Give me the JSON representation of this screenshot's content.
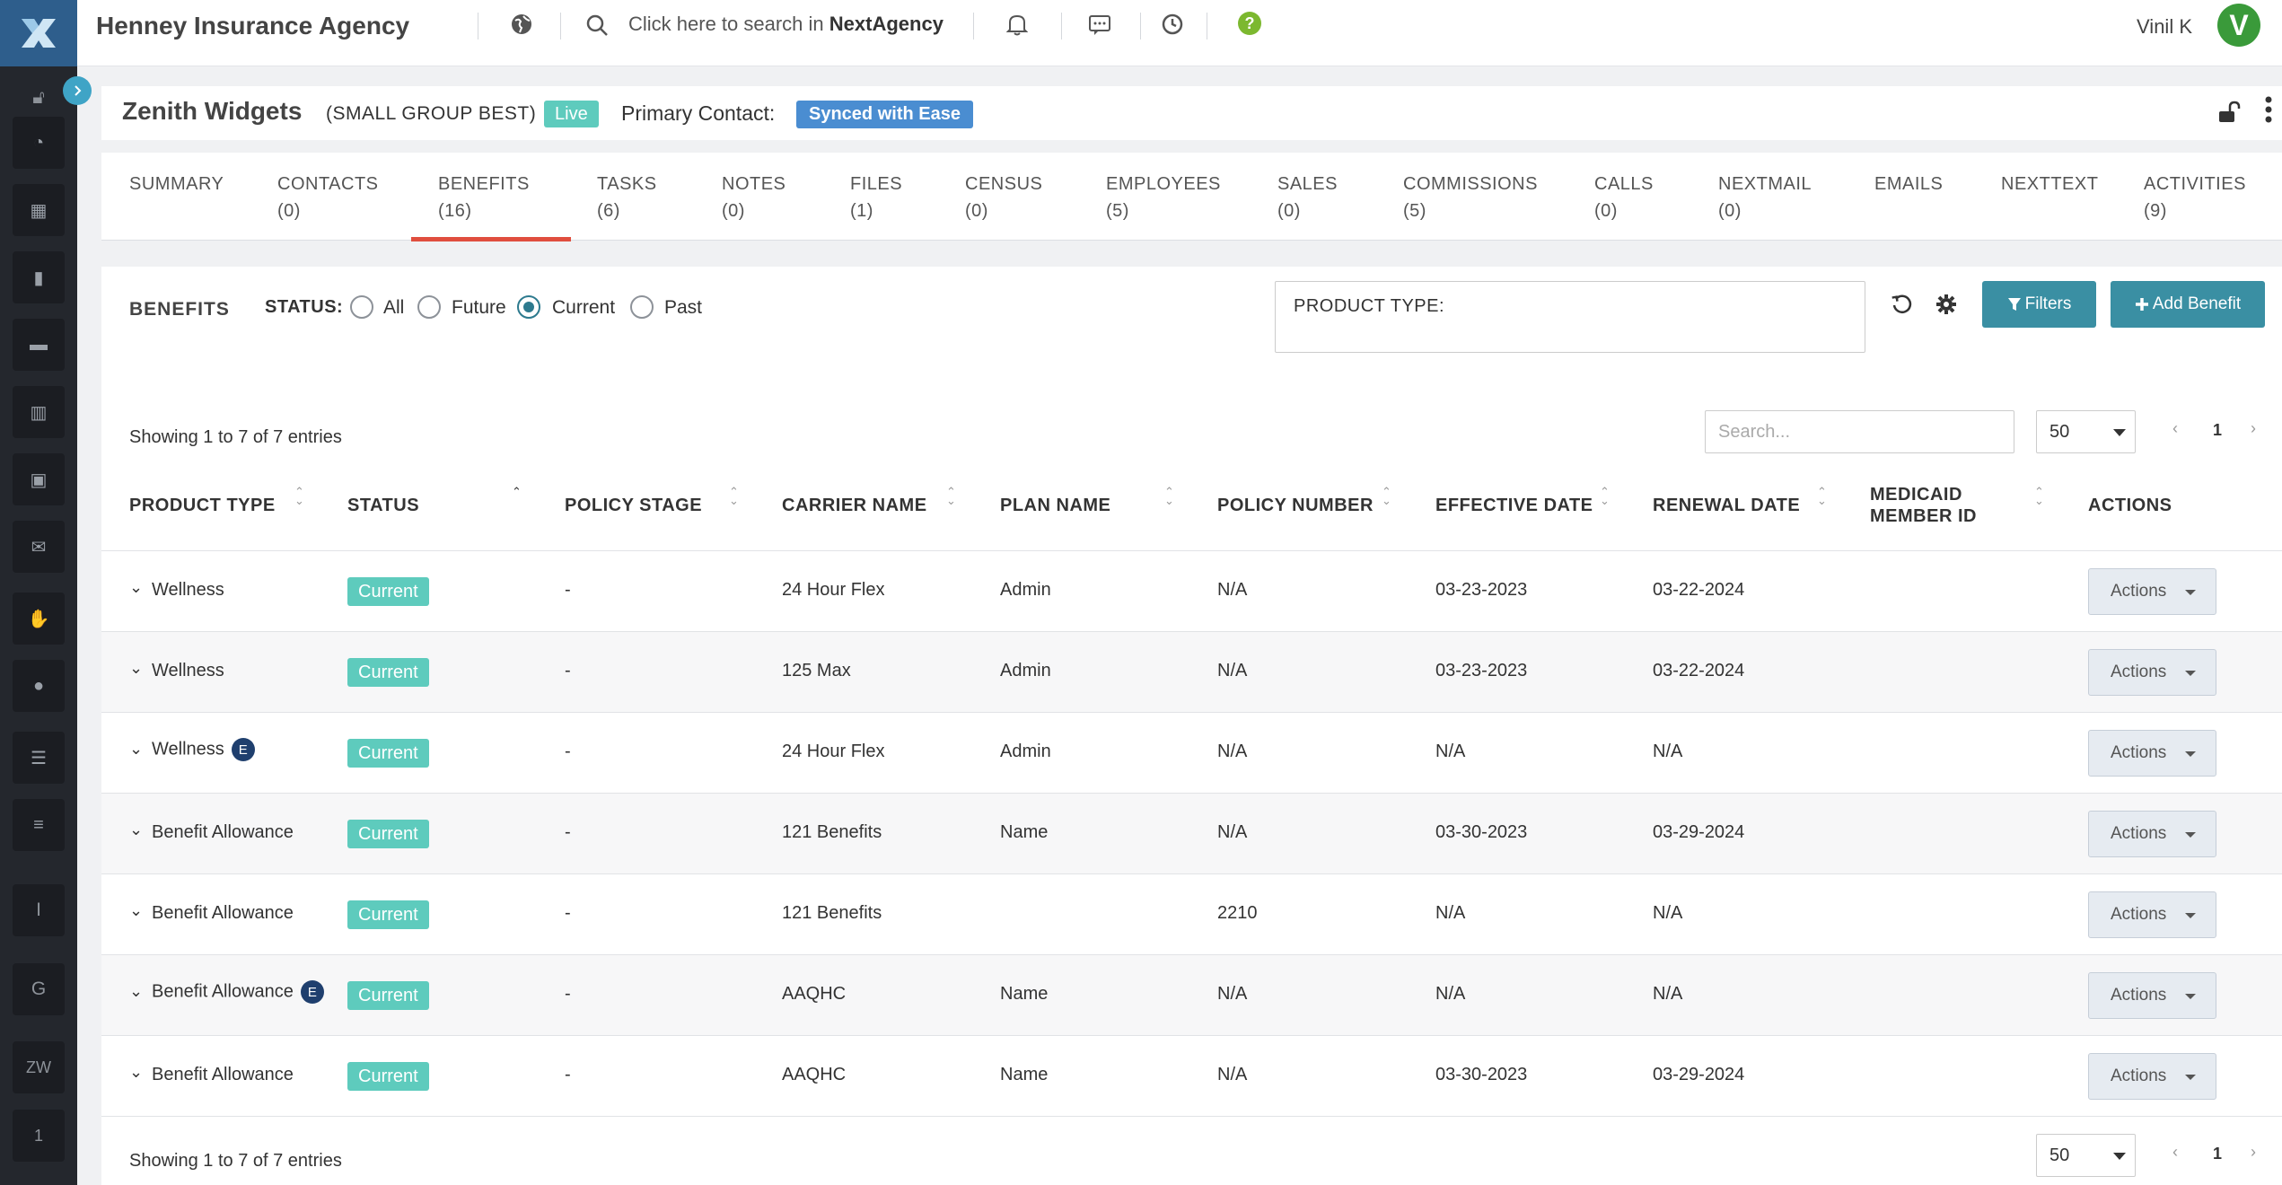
{
  "topbar": {
    "agency": "Henney Insurance Agency",
    "search_prefix": "Click here to search in",
    "search_brand": "NextAgency",
    "user": "Vinil K",
    "avatar_letter": "V"
  },
  "sidebar": {
    "bottom_items": [
      "I",
      "G",
      "ZW",
      "1"
    ]
  },
  "header": {
    "title": "Zenith Widgets",
    "type": "(SMALL GROUP BEST)",
    "status": "Live",
    "primary_contact_label": "Primary Contact:",
    "primary_contact": "Synced with Ease"
  },
  "tabs": [
    {
      "label": "SUMMARY",
      "count": ""
    },
    {
      "label": "CONTACTS",
      "count": "(0)"
    },
    {
      "label": "BENEFITS",
      "count": "(16)"
    },
    {
      "label": "TASKS",
      "count": "(6)"
    },
    {
      "label": "NOTES",
      "count": "(0)"
    },
    {
      "label": "FILES",
      "count": "(1)"
    },
    {
      "label": "CENSUS",
      "count": "(0)"
    },
    {
      "label": "EMPLOYEES",
      "count": "(5)"
    },
    {
      "label": "SALES",
      "count": "(0)"
    },
    {
      "label": "COMMISSIONS",
      "count": "(5)"
    },
    {
      "label": "CALLS",
      "count": "(0)"
    },
    {
      "label": "NEXTMAIL",
      "count": "(0)"
    },
    {
      "label": "EMAILS",
      "count": ""
    },
    {
      "label": "NEXTTEXT",
      "count": ""
    },
    {
      "label": "ACTIVITIES",
      "count": "(9)"
    }
  ],
  "active_tab": "BENEFITS",
  "benefits": {
    "title": "BENEFITS",
    "status_label": "STATUS:",
    "radios": [
      "All",
      "Future",
      "Current",
      "Past"
    ],
    "selected_status": "Current",
    "product_type_label": "PRODUCT TYPE:",
    "filters_label": "Filters",
    "add_label": "Add Benefit",
    "showing": "Showing 1 to 7 of 7 entries",
    "search_placeholder": "Search...",
    "page_length": "50",
    "page": "1"
  },
  "table": {
    "headers": [
      "PRODUCT TYPE",
      "STATUS",
      "POLICY STAGE",
      "CARRIER NAME",
      "PLAN NAME",
      "POLICY NUMBER",
      "EFFECTIVE DATE",
      "RENEWAL DATE",
      "MEDICAID MEMBER ID",
      "ACTIONS"
    ],
    "rows": [
      {
        "product": "Wellness",
        "badge": "",
        "status": "Current",
        "stage": "-",
        "carrier": "24 Hour Flex",
        "plan": "Admin",
        "policy": "N/A",
        "effective": "03-23-2023",
        "renewal": "03-22-2024",
        "medicaid": "",
        "action": "Actions"
      },
      {
        "product": "Wellness",
        "badge": "",
        "status": "Current",
        "stage": "-",
        "carrier": "125 Max",
        "plan": "Admin",
        "policy": "N/A",
        "effective": "03-23-2023",
        "renewal": "03-22-2024",
        "medicaid": "",
        "action": "Actions"
      },
      {
        "product": "Wellness",
        "badge": "E",
        "status": "Current",
        "stage": "-",
        "carrier": "24 Hour Flex",
        "plan": "Admin",
        "policy": "N/A",
        "effective": "N/A",
        "renewal": "N/A",
        "medicaid": "",
        "action": "Actions"
      },
      {
        "product": "Benefit Allowance",
        "badge": "",
        "status": "Current",
        "stage": "-",
        "carrier": "121 Benefits",
        "plan": "Name",
        "policy": "N/A",
        "effective": "03-30-2023",
        "renewal": "03-29-2024",
        "medicaid": "",
        "action": "Actions"
      },
      {
        "product": "Benefit Allowance",
        "badge": "",
        "status": "Current",
        "stage": "-",
        "carrier": "121 Benefits",
        "plan": "",
        "policy": "2210",
        "effective": "N/A",
        "renewal": "N/A",
        "medicaid": "",
        "action": "Actions"
      },
      {
        "product": "Benefit Allowance",
        "badge": "E",
        "status": "Current",
        "stage": "-",
        "carrier": "AAQHC",
        "plan": "Name",
        "policy": "N/A",
        "effective": "N/A",
        "renewal": "N/A",
        "medicaid": "",
        "action": "Actions"
      },
      {
        "product": "Benefit Allowance",
        "badge": "",
        "status": "Current",
        "stage": "-",
        "carrier": "AAQHC",
        "plan": "Name",
        "policy": "N/A",
        "effective": "03-30-2023",
        "renewal": "03-29-2024",
        "medicaid": "",
        "action": "Actions"
      }
    ]
  },
  "colors": {
    "sidebar": "#24272d",
    "accent": "#3a8fa3",
    "status_badge": "#5ecbbd",
    "active_tab_underline": "#e04e3e",
    "primary_contact_badge": "#4a8dd1"
  }
}
